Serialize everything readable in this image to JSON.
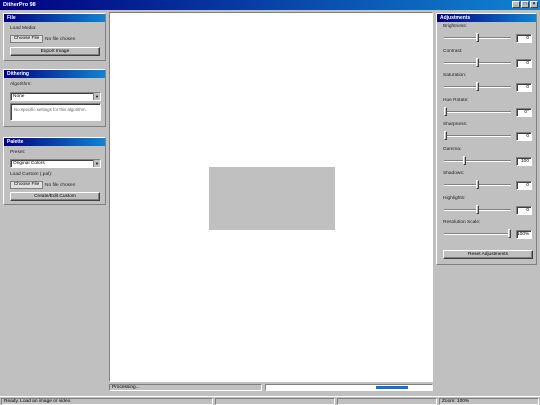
{
  "app": {
    "title": "DitherPro 98"
  },
  "window_buttons": [
    "_",
    "□",
    "×"
  ],
  "file_panel": {
    "title": "File",
    "load_media_label": "Load Media:",
    "choose_file_label": "Choose File",
    "no_file_label": "No file chosen",
    "export_label": "Export Image"
  },
  "dithering_panel": {
    "title": "Dithering",
    "algorithm_label": "Algorithm:",
    "algorithm_value": "None",
    "note": "No specific settings for this algorithm."
  },
  "palette_panel": {
    "title": "Palette",
    "preset_label": "Preset:",
    "preset_value": "Original Colors",
    "load_custom_label": "Load Custom (.pal):",
    "choose_file_label": "Choose File",
    "no_file_label": "No file chosen",
    "create_edit_label": "Create/Edit Custom"
  },
  "adjustments": {
    "title": "Adjustments",
    "items": [
      {
        "label": "Brightness:",
        "value": "0",
        "level": 0.5
      },
      {
        "label": "Contrast:",
        "value": "0",
        "level": 0.5
      },
      {
        "label": "Saturation:",
        "value": "0",
        "level": 0.5
      },
      {
        "label": "Hue Rotate:",
        "value": "0°",
        "level": 0.0
      },
      {
        "label": "Sharpness:",
        "value": "0",
        "level": 0.0
      },
      {
        "label": "Gamma:",
        "value": "100",
        "level": 0.3
      },
      {
        "label": "Shadows:",
        "value": "0",
        "level": 0.5
      },
      {
        "label": "Highlights:",
        "value": "0",
        "level": 0.5
      },
      {
        "label": "Resolution Scale:",
        "value": "100%",
        "level": 1.0
      }
    ],
    "reset_label": "Reset Adjustments"
  },
  "processing": {
    "label": "Processing..."
  },
  "status": {
    "left": "Ready. Load an image or video.",
    "zoom": "Zoom: 100%"
  }
}
